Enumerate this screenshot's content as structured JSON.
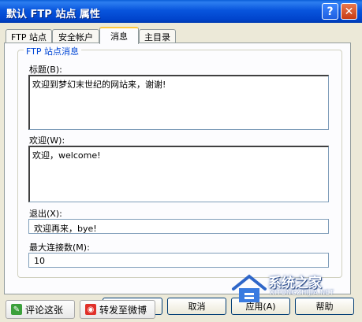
{
  "window": {
    "title": "默认 FTP 站点 属性",
    "help_button": "?",
    "close_button": "✕"
  },
  "tabs": [
    {
      "label": "FTP 站点",
      "active": false
    },
    {
      "label": "安全帐户",
      "active": false
    },
    {
      "label": "消息",
      "active": true
    },
    {
      "label": "主目录",
      "active": false
    }
  ],
  "group": {
    "legend": "FTP 站点消息",
    "banner_label": "标题(B):",
    "banner_value": "欢迎到梦幻末世纪的网站来，谢谢!",
    "welcome_label": "欢迎(W):",
    "welcome_value": "欢迎，welcome!",
    "exit_label": "退出(X):",
    "exit_value": "欢迎再来，bye!",
    "max_conn_label": "最大连接数(M):",
    "max_conn_value": "10"
  },
  "buttons": {
    "cancel": "取消",
    "apply": "应用(A)",
    "help": "帮助"
  },
  "overlay": {
    "comment_button": "评论这张",
    "share_button": "转发至微博"
  },
  "watermark": {
    "brand": "系统之家",
    "domain": "XITONGZHIJIA.NET"
  }
}
